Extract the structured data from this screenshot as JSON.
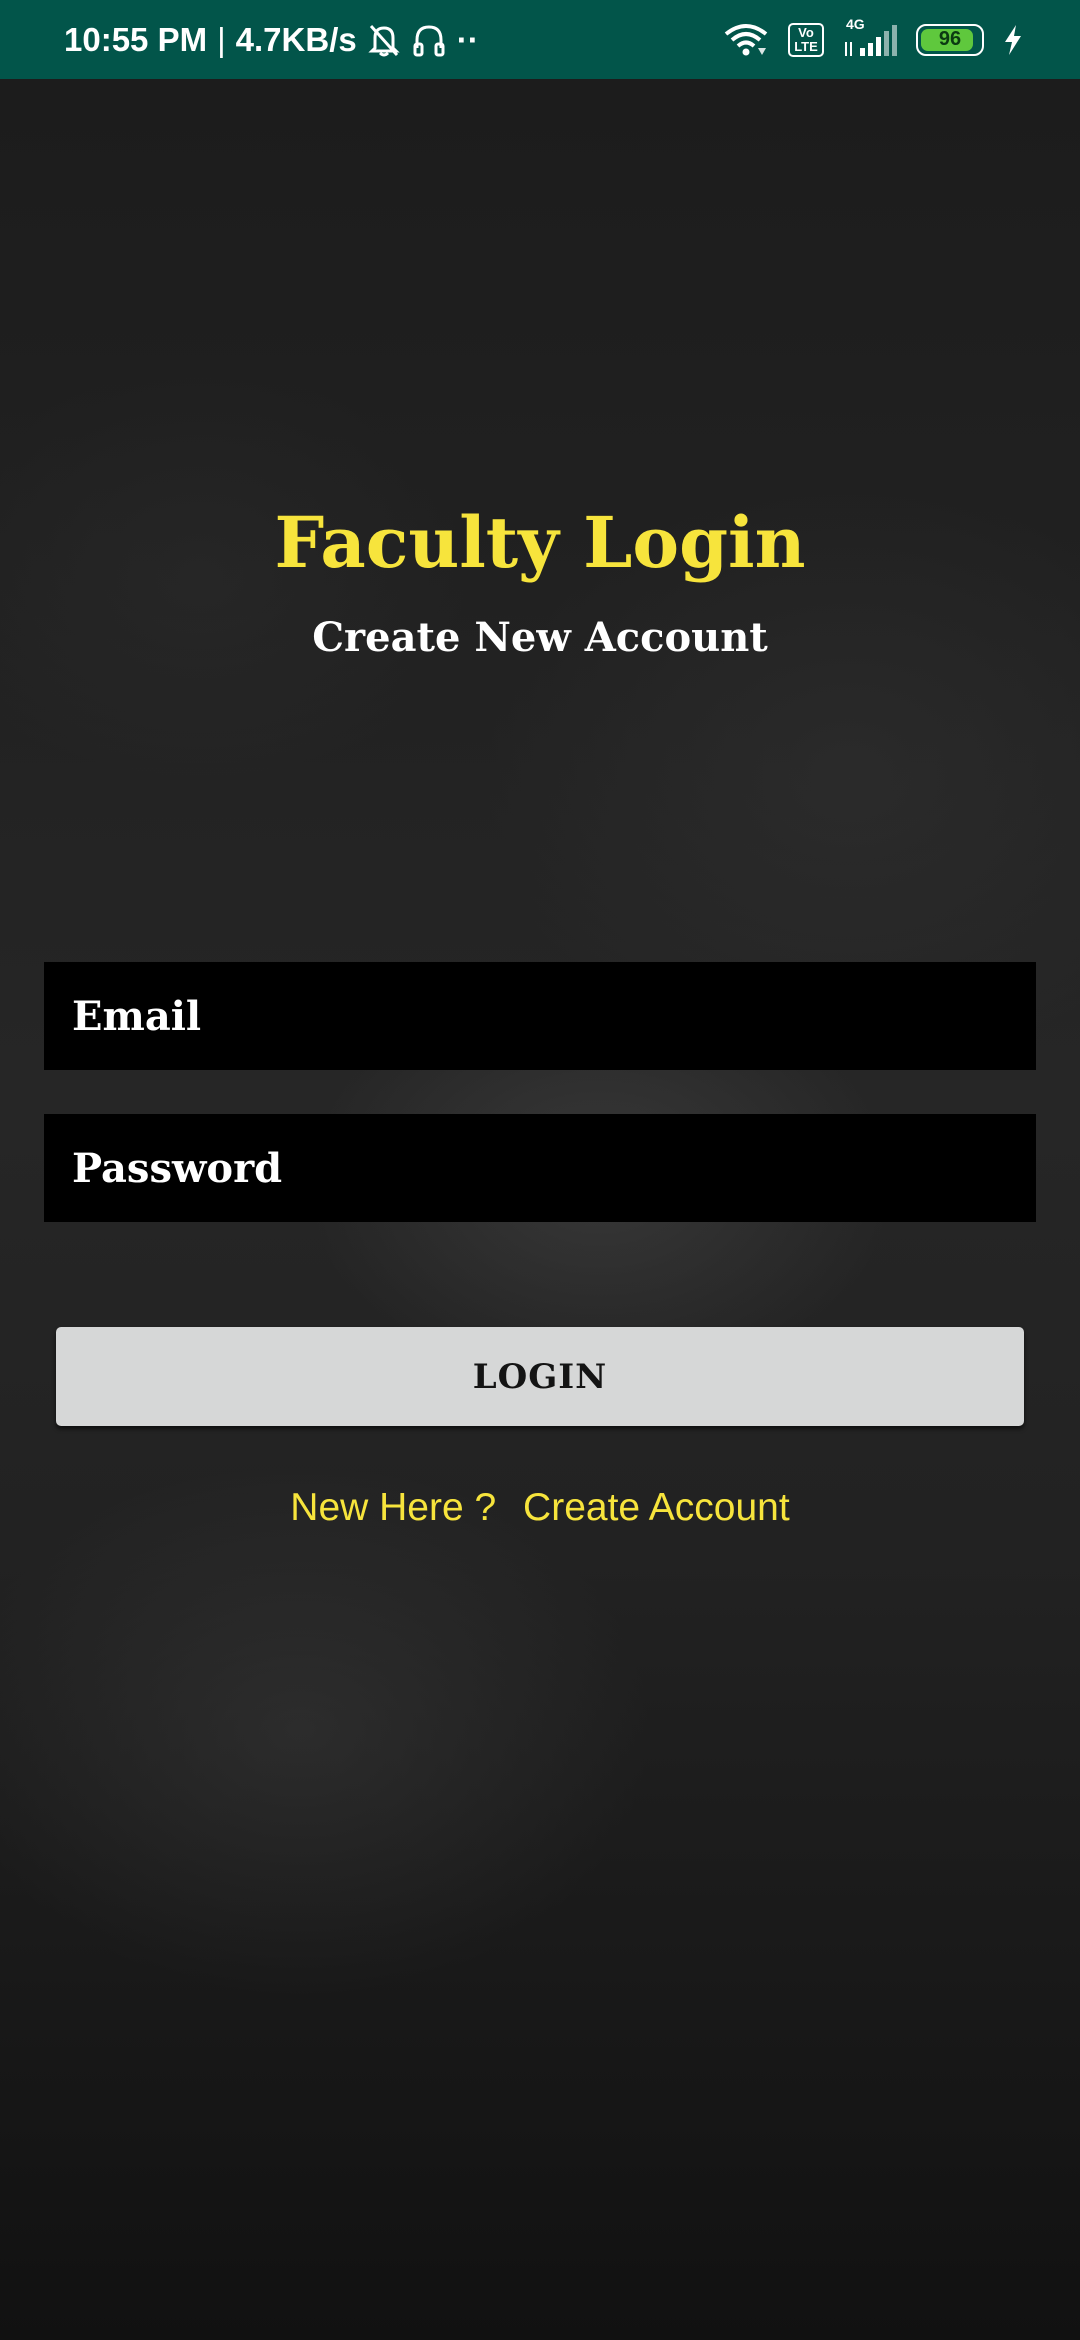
{
  "status_bar": {
    "time": "10:55 PM",
    "separator": "|",
    "network_speed": "4.7KB/s",
    "more_dots": "··",
    "volte": "Vo\nLTE",
    "network_type": "4G",
    "battery_level": "96",
    "battery_fraction": 0.96,
    "icons": [
      "mute-bell-icon",
      "headset-icon",
      "wifi-icon",
      "volte-icon",
      "signal-icon",
      "battery-icon",
      "charging-icon"
    ],
    "background_color": "#02554a"
  },
  "page": {
    "title": "Faculty Login",
    "subtitle": "Create New Account"
  },
  "form": {
    "email_placeholder": "Email",
    "password_placeholder": "Password",
    "login_label": "LOGIN"
  },
  "signup": {
    "prompt": "New Here ?",
    "link_label": "Create Account"
  },
  "colors": {
    "accent_yellow": "#f7e43c",
    "button_gray": "#d6d7d7",
    "field_black": "#000000"
  }
}
